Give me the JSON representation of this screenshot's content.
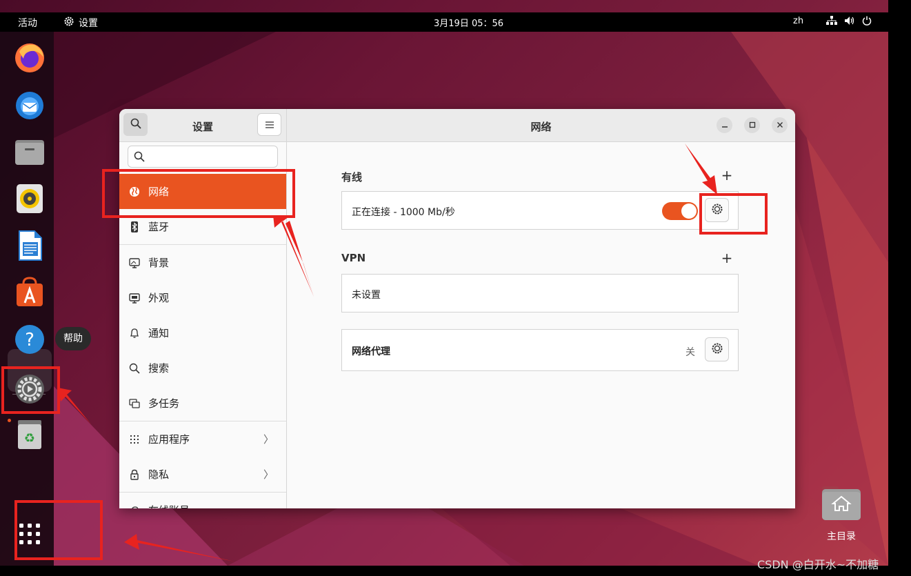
{
  "topbar": {
    "activities": "活动",
    "app_name": "设置",
    "clock": "3月19日  05：56",
    "lang": "zh",
    "tray_icons": [
      "network-icon",
      "volume-icon",
      "power-icon"
    ]
  },
  "dock": {
    "apps": [
      "firefox",
      "thunderbird",
      "files",
      "rhythmbox",
      "libreoffice-writer",
      "app-center",
      "help",
      "settings",
      "trash"
    ],
    "tooltip": "帮助",
    "show_apps": "show-apps-grid"
  },
  "window": {
    "sidebar": {
      "title": "设置",
      "search_placeholder": "",
      "items": [
        {
          "label": "网络",
          "icon": "globe-icon",
          "active": true
        },
        {
          "label": "蓝牙",
          "icon": "bluetooth-icon"
        },
        {
          "label": "背景",
          "icon": "monitor-icon"
        },
        {
          "label": "外观",
          "icon": "appearance-icon"
        },
        {
          "label": "通知",
          "icon": "bell-icon"
        },
        {
          "label": "搜索",
          "icon": "search-icon"
        },
        {
          "label": "多任务",
          "icon": "multitask-icon"
        },
        {
          "label": "应用程序",
          "icon": "apps-grid-icon",
          "arrow": "〉"
        },
        {
          "label": "隐私",
          "icon": "lock-icon",
          "arrow": "〉"
        },
        {
          "label": "在线账号",
          "icon": "cloud-icon"
        }
      ]
    },
    "main": {
      "title": "网络",
      "wired": {
        "label": "有线",
        "add": "+",
        "connection": "正在连接 - 1000 Mb/秒",
        "toggle_on": true
      },
      "vpn": {
        "label": "VPN",
        "add": "+",
        "status": "未设置"
      },
      "proxy": {
        "label": "网络代理",
        "state": "关"
      }
    }
  },
  "desktop": {
    "home_folder": "主目录"
  },
  "watermark": "CSDN @白开水~不加糖",
  "colors": {
    "accent": "#e95420",
    "annotation": "#e8231f"
  }
}
